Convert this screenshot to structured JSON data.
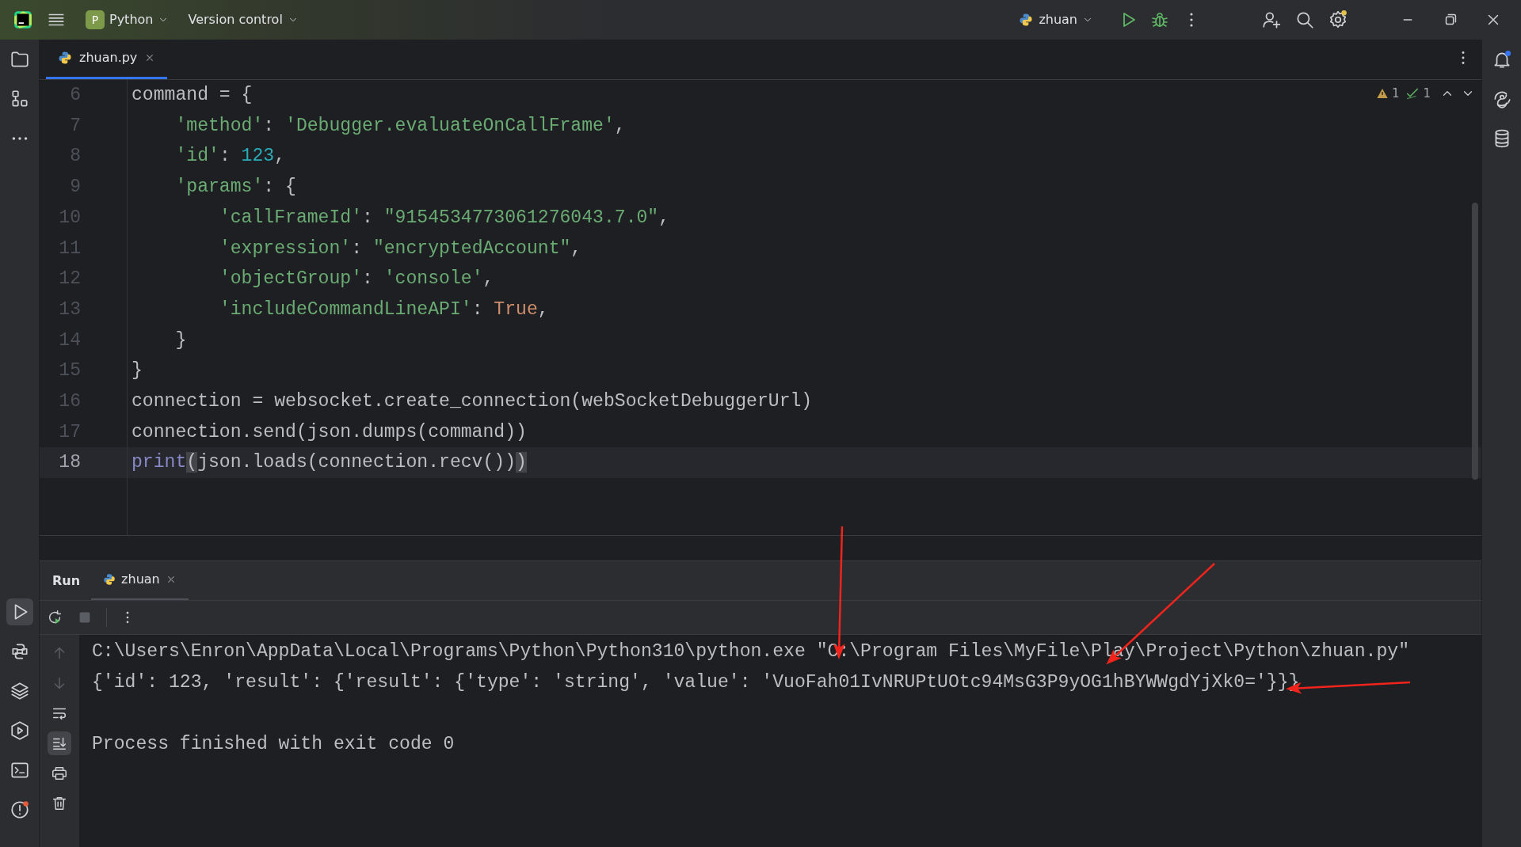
{
  "title_bar": {
    "project_badge": "P",
    "project": "Python",
    "vcs": "Version control",
    "run_config": "zhuan"
  },
  "editor_tabs": [
    {
      "label": "zhuan.py",
      "selected": true
    }
  ],
  "inspections": {
    "warnings": "1",
    "checks": "1"
  },
  "code_lines": [
    {
      "number": "6",
      "current": false,
      "tokens": [
        {
          "kind": "plain",
          "text": "command = {"
        }
      ],
      "children": [
        {
          "number": "7",
          "current": false,
          "tokens": [
            {
              "kind": "str",
              "text": "'method'"
            },
            {
              "kind": "plain",
              "text": ": "
            },
            {
              "kind": "str",
              "text": "'Debugger.evaluateOnCallFrame'"
            },
            {
              "kind": "plain",
              "text": ","
            }
          ]
        },
        {
          "number": "8",
          "current": false,
          "tokens": [
            {
              "kind": "str",
              "text": "'id'"
            },
            {
              "kind": "plain",
              "text": ": "
            },
            {
              "kind": "num",
              "text": "123"
            },
            {
              "kind": "plain",
              "text": ","
            }
          ]
        },
        {
          "number": "9",
          "current": false,
          "tokens": [
            {
              "kind": "str",
              "text": "'params'"
            },
            {
              "kind": "plain",
              "text": ": {"
            }
          ],
          "children": [
            {
              "number": "10",
              "current": false,
              "tokens": [
                {
                  "kind": "str",
                  "text": "'callFrameId'"
                },
                {
                  "kind": "plain",
                  "text": ": "
                },
                {
                  "kind": "str",
                  "text": "\"9154534773061276043.7.0\""
                },
                {
                  "kind": "plain",
                  "text": ","
                }
              ]
            },
            {
              "number": "11",
              "current": false,
              "tokens": [
                {
                  "kind": "str",
                  "text": "'expression'"
                },
                {
                  "kind": "plain",
                  "text": ": "
                },
                {
                  "kind": "str",
                  "text": "\"encryptedAccount\""
                },
                {
                  "kind": "plain",
                  "text": ","
                }
              ]
            },
            {
              "number": "12",
              "current": false,
              "tokens": [
                {
                  "kind": "str",
                  "text": "'objectGroup'"
                },
                {
                  "kind": "plain",
                  "text": ": "
                },
                {
                  "kind": "str",
                  "text": "'console'"
                },
                {
                  "kind": "plain",
                  "text": ","
                }
              ]
            },
            {
              "number": "13",
              "current": false,
              "tokens": [
                {
                  "kind": "str",
                  "text": "'includeCommandLineAPI'"
                },
                {
                  "kind": "plain",
                  "text": ": "
                },
                {
                  "kind": "kw",
                  "text": "True"
                },
                {
                  "kind": "plain",
                  "text": ","
                }
              ]
            }
          ]
        },
        {
          "number": "14",
          "current": false,
          "tokens": [
            {
              "kind": "plain",
              "text": "}"
            }
          ]
        }
      ]
    },
    {
      "number": "15",
      "current": false,
      "tokens": [
        {
          "kind": "plain",
          "text": "}"
        }
      ]
    },
    {
      "number": "16",
      "current": false,
      "tokens": [
        {
          "kind": "plain",
          "text": "connection = websocket.create_connection(webSocketDebuggerUrl)"
        }
      ]
    },
    {
      "number": "17",
      "current": false,
      "tokens": [
        {
          "kind": "plain",
          "text": "connection.send(json.dumps(command))"
        }
      ]
    },
    {
      "number": "18",
      "current": true,
      "tokens": [
        {
          "kind": "builtin",
          "text": "print"
        },
        {
          "kind": "brace",
          "text": "("
        },
        {
          "kind": "plain",
          "text": "json.loads(connection.recv())"
        },
        {
          "kind": "brace",
          "text": ")"
        }
      ]
    }
  ],
  "run_panel": {
    "title": "Run",
    "tabs": [
      {
        "label": "zhuan",
        "selected": true
      }
    ],
    "output": [
      {
        "kind": "text",
        "text": "C:\\Users\\Enron\\AppData\\Local\\Programs\\Python\\Python310\\python.exe \"C:\\Program Files\\MyFile\\Play\\Project\\Python\\zhuan.py\""
      },
      {
        "kind": "text",
        "text": "{'id': 123, 'result': {'result': {'type': 'string', 'value': 'VuoFah01IvNRUPtUOtc94MsG3P9yOG1hBYWWgdYjXk0='}}}"
      },
      {
        "kind": "blank"
      },
      {
        "kind": "text",
        "text": "Process finished with exit code 0"
      }
    ]
  }
}
